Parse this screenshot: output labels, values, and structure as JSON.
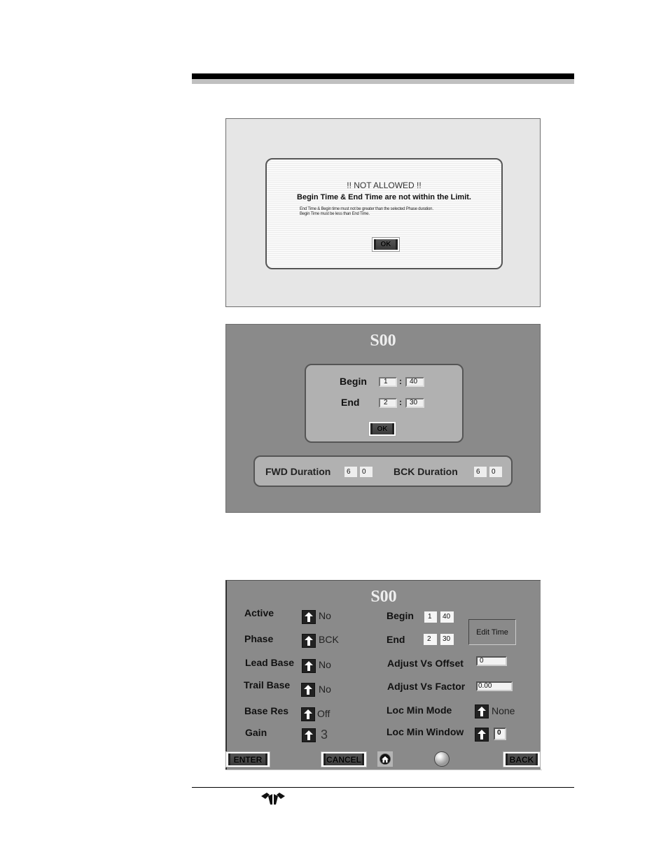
{
  "dialog_screen": {
    "title": "!! NOT ALLOWED !!",
    "message": "Begin Time & End Time are not within the Limit.",
    "detail_line1": "End Time & Begin time must not be greater than the selected Phase duration.",
    "detail_line2": "Begin Time must be less than End Time.",
    "ok_label": "OK"
  },
  "edit_time_screen": {
    "title": "S00",
    "begin_label": "Begin",
    "begin_min": "1",
    "begin_sec": "40",
    "end_label": "End",
    "end_min": "2",
    "end_sec": "30",
    "separator": ":",
    "ok_label": "OK",
    "fwd_duration_label": "FWD Duration",
    "fwd_duration_min": "6",
    "fwd_duration_sec": "0",
    "bck_duration_label": "BCK Duration",
    "bck_duration_min": "6",
    "bck_duration_sec": "0"
  },
  "settings_screen": {
    "title": "S00",
    "left_fields": [
      {
        "label": "Active",
        "value": "No"
      },
      {
        "label": "Phase",
        "value": "BCK"
      },
      {
        "label": "Lead Base",
        "value": "No"
      },
      {
        "label": "Trail Base",
        "value": "No"
      },
      {
        "label": "Base Res",
        "value": "Off"
      },
      {
        "label": "Gain",
        "value": "3"
      }
    ],
    "begin_label": "Begin",
    "begin_min": "1",
    "begin_sec": "40",
    "end_label": "End",
    "end_min": "2",
    "end_sec": "30",
    "edit_time_label": "Edit Time",
    "adjust_offset_label": "Adjust Vs Offset",
    "adjust_offset_value": "0",
    "adjust_factor_label": "Adjust Vs Factor",
    "adjust_factor_value": "0.00",
    "loc_min_mode_label": "Loc Min Mode",
    "loc_min_mode_value": "None",
    "loc_min_window_label": "Loc Min Window",
    "loc_min_window_value": "0",
    "enter_label": "ENTER",
    "cancel_label": "CANCEL",
    "back_label": "BACK",
    "home_icon": "home-icon",
    "status_icon": "status-indicator-icon"
  },
  "footer": {
    "logo": "teledyne-logo-icon"
  }
}
